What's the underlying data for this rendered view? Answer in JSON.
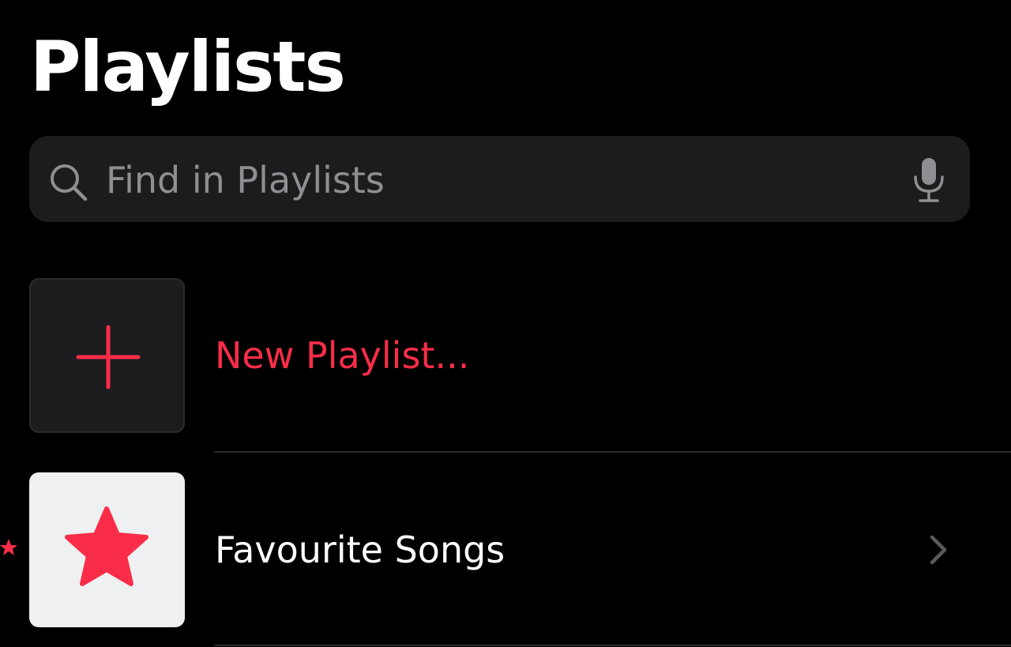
{
  "header": {
    "title": "Playlists"
  },
  "search": {
    "placeholder": "Find in Playlists",
    "value": "",
    "icon": "magnifying-glass",
    "mic_icon": "microphone"
  },
  "playlists": [
    {
      "label": "New Playlist...",
      "artwork_icon": "plus",
      "color": "#fa2d48"
    },
    {
      "label": "Favourite Songs",
      "artwork_icon": "star",
      "color": "#fa2d48",
      "chevron_icon": "chevron-right"
    }
  ],
  "theme": {
    "background": "#000000",
    "accent": "#fa2d48",
    "search_background": "#1c1c1e",
    "secondary_text": "#8e8e93"
  }
}
